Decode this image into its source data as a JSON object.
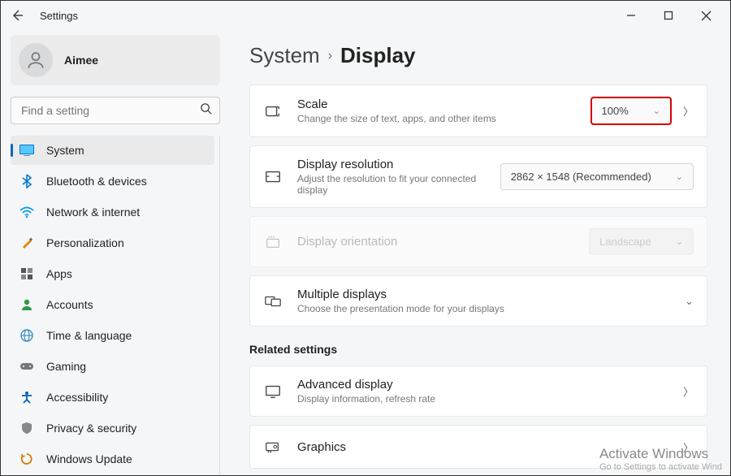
{
  "window": {
    "title": "Settings"
  },
  "profile": {
    "name": "Aimee"
  },
  "search": {
    "placeholder": "Find a setting"
  },
  "sidebar": {
    "items": [
      {
        "label": "System",
        "icon": "system",
        "color": "#0078d4",
        "selected": true
      },
      {
        "label": "Bluetooth & devices",
        "icon": "bluetooth",
        "color": "#0078d4"
      },
      {
        "label": "Network & internet",
        "icon": "wifi",
        "color": "#0099ee"
      },
      {
        "label": "Personalization",
        "icon": "brush",
        "color": "#e08700"
      },
      {
        "label": "Apps",
        "icon": "apps",
        "color": "#555"
      },
      {
        "label": "Accounts",
        "icon": "person",
        "color": "#2e9948"
      },
      {
        "label": "Time & language",
        "icon": "globe",
        "color": "#3a8fc7"
      },
      {
        "label": "Gaming",
        "icon": "gaming",
        "color": "#777"
      },
      {
        "label": "Accessibility",
        "icon": "accessibility",
        "color": "#0060b0"
      },
      {
        "label": "Privacy & security",
        "icon": "shield",
        "color": "#888"
      },
      {
        "label": "Windows Update",
        "icon": "update",
        "color": "#d97a00"
      }
    ]
  },
  "breadcrumb": {
    "parent": "System",
    "current": "Display"
  },
  "cards": {
    "scale": {
      "title": "Scale",
      "sub": "Change the size of text, apps, and other items",
      "value": "100%",
      "highlight": true
    },
    "resolution": {
      "title": "Display resolution",
      "sub": "Adjust the resolution to fit your connected display",
      "value": "2862 × 1548 (Recommended)"
    },
    "orientation": {
      "title": "Display orientation",
      "value": "Landscape",
      "disabled": true
    },
    "multiple": {
      "title": "Multiple displays",
      "sub": "Choose the presentation mode for your displays"
    }
  },
  "related": {
    "heading": "Related settings",
    "advanced": {
      "title": "Advanced display",
      "sub": "Display information, refresh rate"
    },
    "graphics": {
      "title": "Graphics"
    }
  },
  "watermark": {
    "line1": "Activate Windows",
    "line2": "Go to Settings to activate Wind"
  }
}
